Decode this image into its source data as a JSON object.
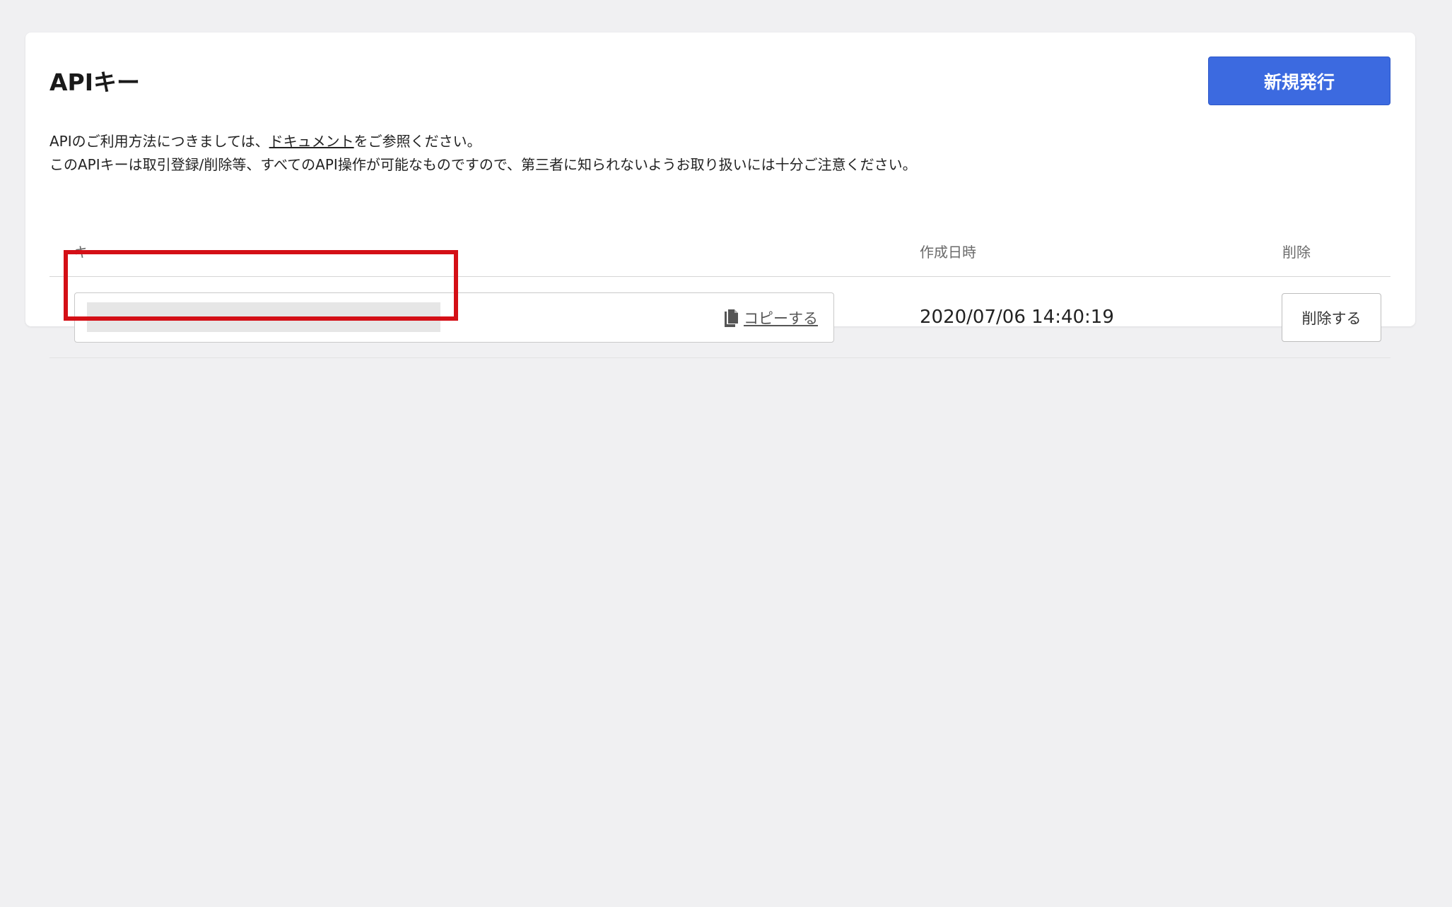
{
  "header": {
    "title": "APIキー",
    "new_button_label": "新規発行"
  },
  "description": {
    "line1_before": "APIのご利用方法につきましては、",
    "doc_link": "ドキュメント",
    "line1_after": "をご参照ください。",
    "line2": "このAPIキーは取引登録/削除等、すべてのAPI操作が可能なものですので、第三者に知られないようお取り扱いには十分ご注意ください。"
  },
  "table": {
    "columns": {
      "key": "キー",
      "created_at": "作成日時",
      "delete": "削除"
    },
    "rows": [
      {
        "copy_label": "コピーする",
        "created_at": "2020/07/06 14:40:19",
        "delete_label": "削除する"
      }
    ]
  },
  "colors": {
    "primary_button": "#3c6ae0",
    "highlight_border": "#d40f16",
    "page_background": "#f0f0f2"
  },
  "icons": {
    "copy": "copy-icon"
  }
}
